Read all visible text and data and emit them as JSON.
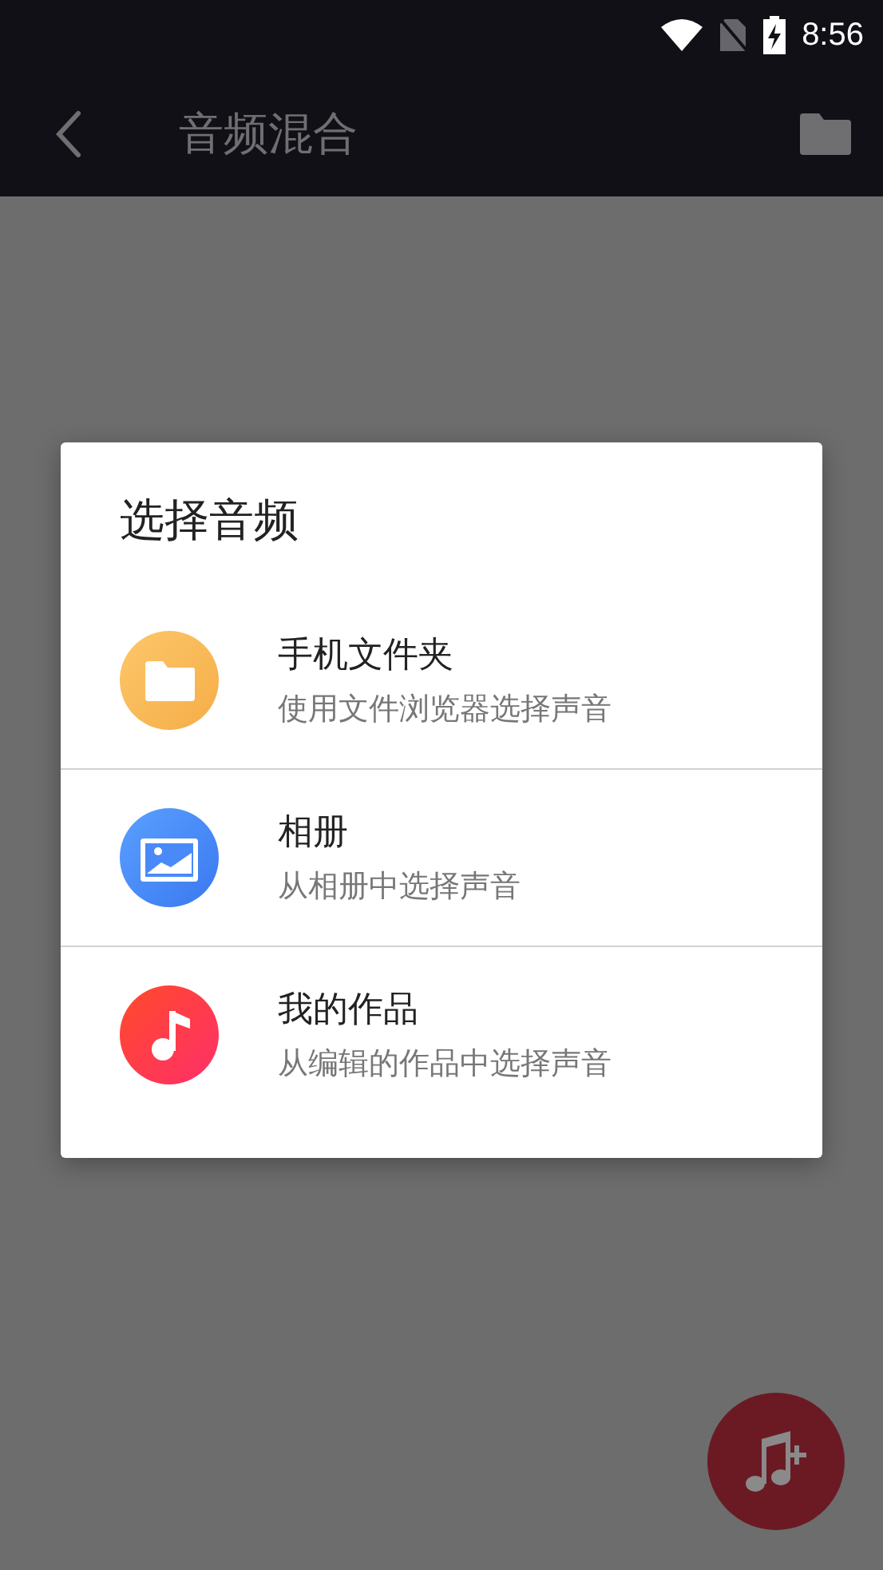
{
  "status_bar": {
    "time": "8:56"
  },
  "toolbar": {
    "title": "音频混合"
  },
  "dialog": {
    "title": "选择音频",
    "items": [
      {
        "kind": "folder",
        "title": "手机文件夹",
        "subtitle": "使用文件浏览器选择声音"
      },
      {
        "kind": "album",
        "title": "相册",
        "subtitle": "从相册中选择声音"
      },
      {
        "kind": "music",
        "title": "我的作品",
        "subtitle": "从编辑的作品中选择声音"
      }
    ]
  }
}
